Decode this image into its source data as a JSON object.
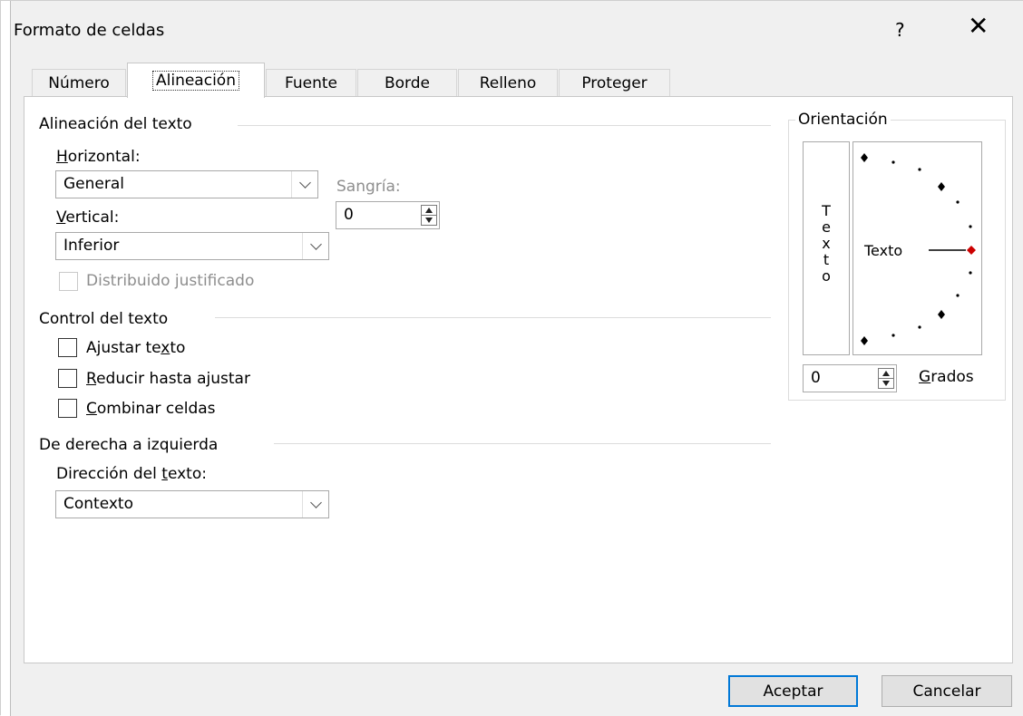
{
  "dialog": {
    "title": "Formato de celdas",
    "help": "?",
    "close": "✕"
  },
  "tabs": [
    {
      "label": "Número"
    },
    {
      "label": "Alineación"
    },
    {
      "label": "Fuente"
    },
    {
      "label": "Borde"
    },
    {
      "label": "Relleno"
    },
    {
      "label": "Proteger"
    }
  ],
  "alignment": {
    "section_label": "Alineación del texto",
    "horizontal_label_u": "H",
    "horizontal_label_rest": "orizontal:",
    "horizontal_value": "General",
    "vertical_label_u": "V",
    "vertical_label_rest": "ertical:",
    "vertical_value": "Inferior",
    "indent_label": "Sangría:",
    "indent_value": "0",
    "distributed_label": "Distribuido justificado"
  },
  "text_control": {
    "section_label": "Control del texto",
    "wrap_pre": "Ajustar te",
    "wrap_u": "x",
    "wrap_post": "to",
    "shrink_u": "R",
    "shrink_rest": "educir hasta ajustar",
    "merge_u": "C",
    "merge_rest": "ombinar celdas"
  },
  "rtl": {
    "section_label": "De derecha a izquierda",
    "direction_pre": "Dirección del ",
    "direction_u": "t",
    "direction_post": "exto:",
    "direction_value": "Contexto"
  },
  "orientation": {
    "section_label": "Orientación",
    "vertical_chars": [
      "T",
      "e",
      "x",
      "t",
      "o"
    ],
    "dial_text": "Texto",
    "degrees_value": "0",
    "degrees_label_u": "G",
    "degrees_label_rest": "rados"
  },
  "buttons": {
    "ok": "Aceptar",
    "cancel": "Cancelar"
  },
  "colors": {
    "accent": "#0078d7",
    "dial_marker": "#cc0000"
  }
}
